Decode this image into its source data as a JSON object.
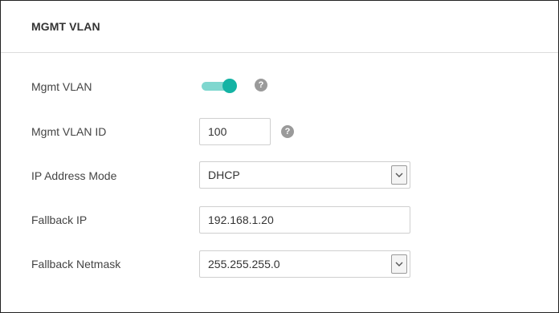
{
  "panel": {
    "title": "MGMT VLAN"
  },
  "fields": {
    "mgmt_vlan": {
      "label": "Mgmt VLAN",
      "enabled": true,
      "help": "?"
    },
    "mgmt_vlan_id": {
      "label": "Mgmt VLAN ID",
      "value": "100",
      "help": "?"
    },
    "ip_address_mode": {
      "label": "IP Address Mode",
      "value": "DHCP"
    },
    "fallback_ip": {
      "label": "Fallback IP",
      "value": "192.168.1.20"
    },
    "fallback_netmask": {
      "label": "Fallback Netmask",
      "value": "255.255.255.0"
    }
  },
  "icons": {
    "help": "question-circle-icon",
    "dropdown": "chevron-down-icon"
  },
  "colors": {
    "toggle_on_knob": "#14b3a4",
    "toggle_on_track": "#7fd7cf",
    "help_icon": "#9a9a9a",
    "border": "#cfcfcf"
  }
}
